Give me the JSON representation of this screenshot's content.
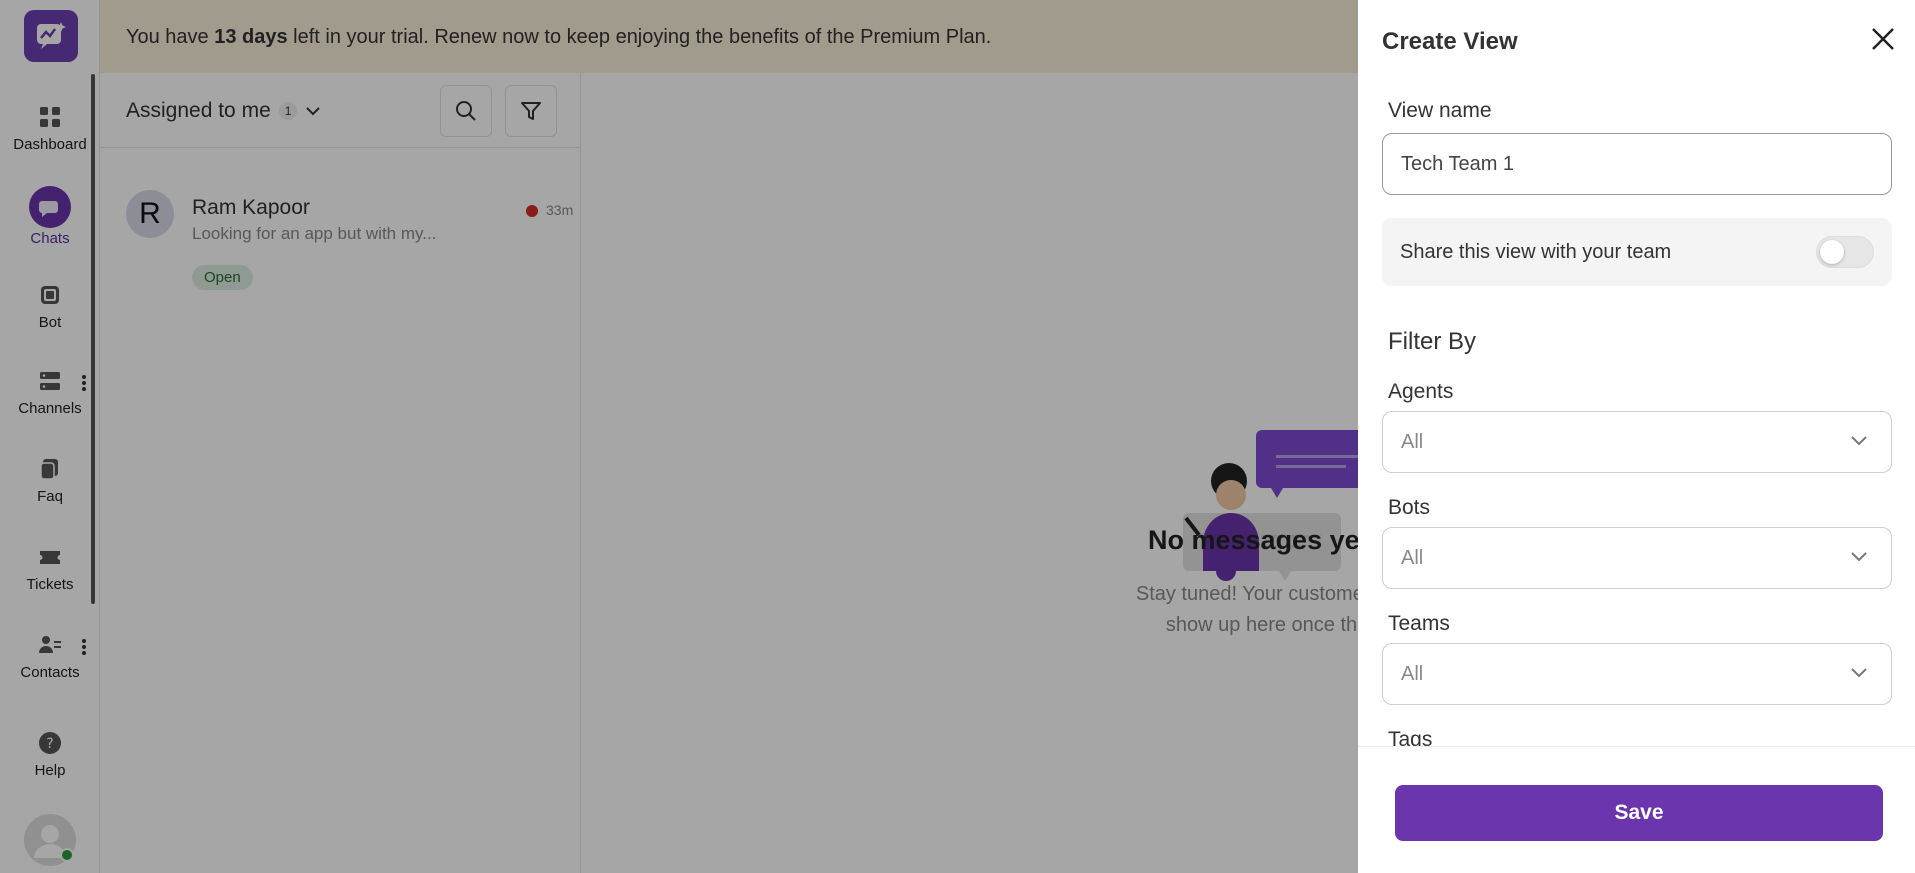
{
  "banner": {
    "prefix": "You have ",
    "days": "13 days",
    "suffix": " left in your trial. Renew now to keep enjoying the benefits of the Premium Plan."
  },
  "nav": {
    "items": [
      {
        "label": "Dashboard",
        "icon": "dashboard-icon"
      },
      {
        "label": "Chats",
        "icon": "chats-icon",
        "active": true
      },
      {
        "label": "Bot",
        "icon": "bot-icon"
      },
      {
        "label": "Channels",
        "icon": "channels-icon"
      },
      {
        "label": "Faq",
        "icon": "faq-icon"
      },
      {
        "label": "Tickets",
        "icon": "tickets-icon"
      },
      {
        "label": "Contacts",
        "icon": "contacts-icon"
      },
      {
        "label": "Help",
        "icon": "help-icon"
      }
    ]
  },
  "chat_list": {
    "header": "Assigned to me",
    "count": "1",
    "chats": [
      {
        "initial": "R",
        "name": "Ram Kapoor",
        "preview": "Looking for an app but with my...",
        "time": "33m",
        "status": "Open"
      }
    ]
  },
  "empty_state": {
    "title": "No messages yet",
    "subtitle_line1": "Stay tuned! Your customer conver",
    "subtitle_line2": "show up here once they be"
  },
  "drawer": {
    "title": "Create View",
    "view_name_label": "View name",
    "view_name_value": "Tech Team 1",
    "share_label": "Share this view with your team",
    "share_enabled": false,
    "filter_heading": "Filter By",
    "filters": [
      {
        "label": "Agents",
        "value": "All"
      },
      {
        "label": "Bots",
        "value": "All"
      },
      {
        "label": "Teams",
        "value": "All"
      },
      {
        "label": "Tags"
      }
    ],
    "save_label": "Save"
  },
  "colors": {
    "brand": "#6a35ad",
    "banner_bg": "#f6eed8",
    "status_open_bg": "#dcefe0",
    "unread_dot": "#d62b2b"
  }
}
